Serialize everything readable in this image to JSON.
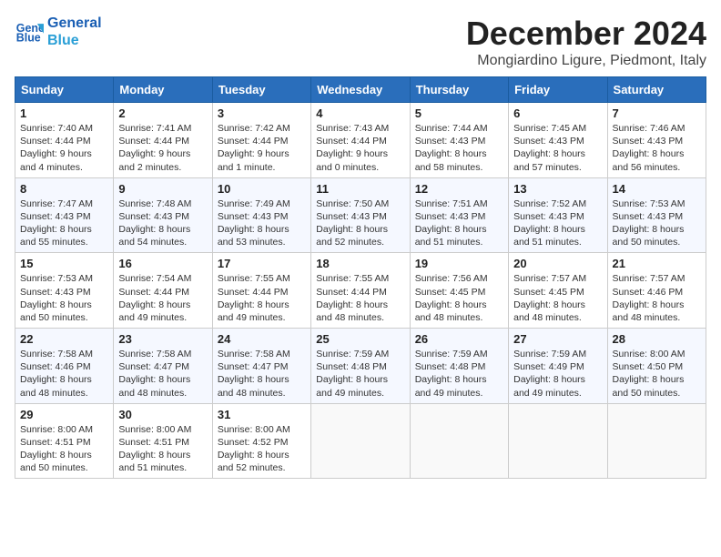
{
  "logo": {
    "line1": "General",
    "line2": "Blue"
  },
  "title": "December 2024",
  "subtitle": "Mongiardino Ligure, Piedmont, Italy",
  "days_header": [
    "Sunday",
    "Monday",
    "Tuesday",
    "Wednesday",
    "Thursday",
    "Friday",
    "Saturday"
  ],
  "weeks": [
    [
      {
        "day": "1",
        "sunrise": "Sunrise: 7:40 AM",
        "sunset": "Sunset: 4:44 PM",
        "daylight": "Daylight: 9 hours and 4 minutes."
      },
      {
        "day": "2",
        "sunrise": "Sunrise: 7:41 AM",
        "sunset": "Sunset: 4:44 PM",
        "daylight": "Daylight: 9 hours and 2 minutes."
      },
      {
        "day": "3",
        "sunrise": "Sunrise: 7:42 AM",
        "sunset": "Sunset: 4:44 PM",
        "daylight": "Daylight: 9 hours and 1 minute."
      },
      {
        "day": "4",
        "sunrise": "Sunrise: 7:43 AM",
        "sunset": "Sunset: 4:44 PM",
        "daylight": "Daylight: 9 hours and 0 minutes."
      },
      {
        "day": "5",
        "sunrise": "Sunrise: 7:44 AM",
        "sunset": "Sunset: 4:43 PM",
        "daylight": "Daylight: 8 hours and 58 minutes."
      },
      {
        "day": "6",
        "sunrise": "Sunrise: 7:45 AM",
        "sunset": "Sunset: 4:43 PM",
        "daylight": "Daylight: 8 hours and 57 minutes."
      },
      {
        "day": "7",
        "sunrise": "Sunrise: 7:46 AM",
        "sunset": "Sunset: 4:43 PM",
        "daylight": "Daylight: 8 hours and 56 minutes."
      }
    ],
    [
      {
        "day": "8",
        "sunrise": "Sunrise: 7:47 AM",
        "sunset": "Sunset: 4:43 PM",
        "daylight": "Daylight: 8 hours and 55 minutes."
      },
      {
        "day": "9",
        "sunrise": "Sunrise: 7:48 AM",
        "sunset": "Sunset: 4:43 PM",
        "daylight": "Daylight: 8 hours and 54 minutes."
      },
      {
        "day": "10",
        "sunrise": "Sunrise: 7:49 AM",
        "sunset": "Sunset: 4:43 PM",
        "daylight": "Daylight: 8 hours and 53 minutes."
      },
      {
        "day": "11",
        "sunrise": "Sunrise: 7:50 AM",
        "sunset": "Sunset: 4:43 PM",
        "daylight": "Daylight: 8 hours and 52 minutes."
      },
      {
        "day": "12",
        "sunrise": "Sunrise: 7:51 AM",
        "sunset": "Sunset: 4:43 PM",
        "daylight": "Daylight: 8 hours and 51 minutes."
      },
      {
        "day": "13",
        "sunrise": "Sunrise: 7:52 AM",
        "sunset": "Sunset: 4:43 PM",
        "daylight": "Daylight: 8 hours and 51 minutes."
      },
      {
        "day": "14",
        "sunrise": "Sunrise: 7:53 AM",
        "sunset": "Sunset: 4:43 PM",
        "daylight": "Daylight: 8 hours and 50 minutes."
      }
    ],
    [
      {
        "day": "15",
        "sunrise": "Sunrise: 7:53 AM",
        "sunset": "Sunset: 4:43 PM",
        "daylight": "Daylight: 8 hours and 50 minutes."
      },
      {
        "day": "16",
        "sunrise": "Sunrise: 7:54 AM",
        "sunset": "Sunset: 4:44 PM",
        "daylight": "Daylight: 8 hours and 49 minutes."
      },
      {
        "day": "17",
        "sunrise": "Sunrise: 7:55 AM",
        "sunset": "Sunset: 4:44 PM",
        "daylight": "Daylight: 8 hours and 49 minutes."
      },
      {
        "day": "18",
        "sunrise": "Sunrise: 7:55 AM",
        "sunset": "Sunset: 4:44 PM",
        "daylight": "Daylight: 8 hours and 48 minutes."
      },
      {
        "day": "19",
        "sunrise": "Sunrise: 7:56 AM",
        "sunset": "Sunset: 4:45 PM",
        "daylight": "Daylight: 8 hours and 48 minutes."
      },
      {
        "day": "20",
        "sunrise": "Sunrise: 7:57 AM",
        "sunset": "Sunset: 4:45 PM",
        "daylight": "Daylight: 8 hours and 48 minutes."
      },
      {
        "day": "21",
        "sunrise": "Sunrise: 7:57 AM",
        "sunset": "Sunset: 4:46 PM",
        "daylight": "Daylight: 8 hours and 48 minutes."
      }
    ],
    [
      {
        "day": "22",
        "sunrise": "Sunrise: 7:58 AM",
        "sunset": "Sunset: 4:46 PM",
        "daylight": "Daylight: 8 hours and 48 minutes."
      },
      {
        "day": "23",
        "sunrise": "Sunrise: 7:58 AM",
        "sunset": "Sunset: 4:47 PM",
        "daylight": "Daylight: 8 hours and 48 minutes."
      },
      {
        "day": "24",
        "sunrise": "Sunrise: 7:58 AM",
        "sunset": "Sunset: 4:47 PM",
        "daylight": "Daylight: 8 hours and 48 minutes."
      },
      {
        "day": "25",
        "sunrise": "Sunrise: 7:59 AM",
        "sunset": "Sunset: 4:48 PM",
        "daylight": "Daylight: 8 hours and 49 minutes."
      },
      {
        "day": "26",
        "sunrise": "Sunrise: 7:59 AM",
        "sunset": "Sunset: 4:48 PM",
        "daylight": "Daylight: 8 hours and 49 minutes."
      },
      {
        "day": "27",
        "sunrise": "Sunrise: 7:59 AM",
        "sunset": "Sunset: 4:49 PM",
        "daylight": "Daylight: 8 hours and 49 minutes."
      },
      {
        "day": "28",
        "sunrise": "Sunrise: 8:00 AM",
        "sunset": "Sunset: 4:50 PM",
        "daylight": "Daylight: 8 hours and 50 minutes."
      }
    ],
    [
      {
        "day": "29",
        "sunrise": "Sunrise: 8:00 AM",
        "sunset": "Sunset: 4:51 PM",
        "daylight": "Daylight: 8 hours and 50 minutes."
      },
      {
        "day": "30",
        "sunrise": "Sunrise: 8:00 AM",
        "sunset": "Sunset: 4:51 PM",
        "daylight": "Daylight: 8 hours and 51 minutes."
      },
      {
        "day": "31",
        "sunrise": "Sunrise: 8:00 AM",
        "sunset": "Sunset: 4:52 PM",
        "daylight": "Daylight: 8 hours and 52 minutes."
      },
      null,
      null,
      null,
      null
    ]
  ]
}
